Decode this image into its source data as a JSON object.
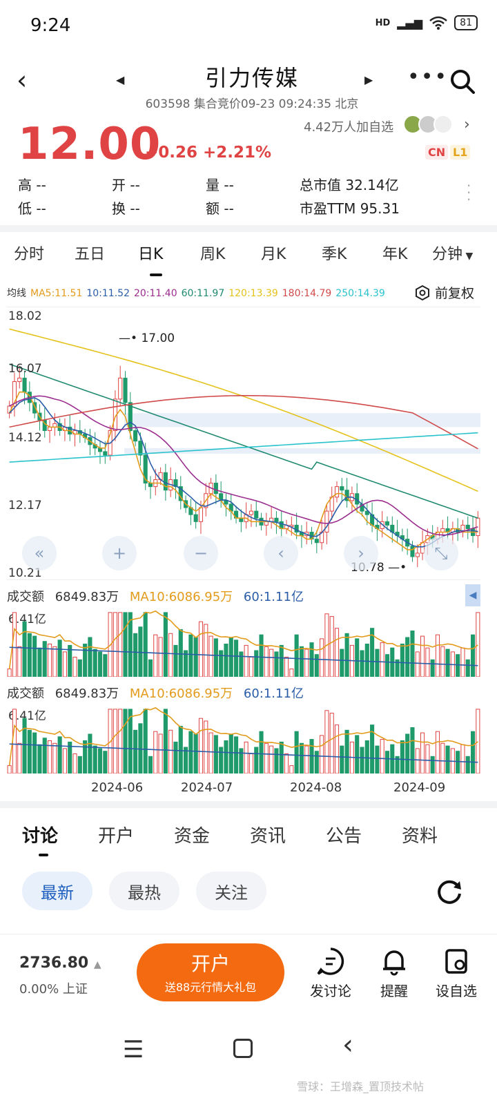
{
  "status": {
    "time": "9:24",
    "network": "HD",
    "battery": "81"
  },
  "header": {
    "title": "引力传媒",
    "subtitle": "603598 集合竞价09-23 09:24:35 北京"
  },
  "quote": {
    "price": "12.00",
    "change": "+0.26 +2.21%",
    "followers": "4.42万人加自选",
    "badge_cn": "CN",
    "badge_l1": "L1"
  },
  "stats": {
    "high_label": "高",
    "high": "--",
    "open_label": "开",
    "open": "--",
    "vol_label": "量",
    "vol": "--",
    "mcap": "总市值 32.14亿",
    "low_label": "低",
    "low": "--",
    "turn_label": "换",
    "turn": "--",
    "amt_label": "额",
    "amt": "--",
    "pe": "市盈TTM 95.31"
  },
  "tabs": [
    "分时",
    "五日",
    "日K",
    "周K",
    "月K",
    "季K",
    "年K",
    "分钟"
  ],
  "active_tab": "日K",
  "ma_legend": [
    {
      "text": "均线",
      "color": "#333333"
    },
    {
      "text": "MA5:11.51",
      "color": "#e39b1b"
    },
    {
      "text": "10:11.52",
      "color": "#2a5da8"
    },
    {
      "text": "20:11.40",
      "color": "#9b2d8e"
    },
    {
      "text": "60:11.97",
      "color": "#1f8a70"
    },
    {
      "text": "120:13.39",
      "color": "#e5c21a"
    },
    {
      "text": "180:14.79",
      "color": "#d04a4a"
    },
    {
      "text": "250:14.39",
      "color": "#29c2cc"
    }
  ],
  "fq_label": "前复权",
  "chart_data": {
    "type": "candlestick",
    "y_ticks": [
      "18.02",
      "16.07",
      "14.12",
      "12.17",
      "10.21"
    ],
    "ylim": [
      10.21,
      18.02
    ],
    "annotations": {
      "high": "17.00",
      "low": "10.78"
    },
    "x_labels": [
      "2024-06",
      "2024-07",
      "2024-08",
      "2024-09"
    ],
    "closes": [
      15.2,
      15.9,
      16.0,
      15.6,
      15.3,
      15.0,
      14.8,
      14.5,
      14.6,
      14.7,
      14.5,
      14.6,
      14.4,
      14.5,
      14.4,
      14.3,
      14.1,
      14.0,
      13.9,
      13.8,
      14.5,
      15.4,
      16.0,
      15.3,
      14.5,
      14.2,
      13.8,
      13.0,
      12.9,
      13.1,
      13.3,
      12.8,
      13.1,
      12.9,
      12.5,
      12.3,
      12.1,
      11.9,
      12.3,
      12.7,
      13.0,
      12.7,
      12.5,
      12.4,
      12.2,
      12.0,
      11.9,
      12.1,
      12.2,
      12.0,
      11.8,
      11.9,
      12.0,
      11.9,
      11.7,
      11.8,
      11.8,
      11.6,
      11.5,
      11.6,
      11.4,
      11.3,
      11.6,
      12.2,
      12.6,
      12.9,
      12.8,
      12.5,
      12.7,
      12.4,
      12.2,
      12.1,
      11.8,
      11.7,
      11.9,
      11.8,
      11.6,
      11.5,
      11.4,
      11.2,
      10.9,
      11.0,
      11.3,
      11.5,
      11.4,
      11.6,
      11.7,
      11.6,
      11.7,
      11.6,
      11.8,
      11.7,
      11.5,
      12.0
    ],
    "ma5": [
      15.0,
      15.3,
      15.6,
      15.6,
      15.5,
      15.2,
      14.9,
      14.7,
      14.6,
      14.6,
      14.6,
      14.5,
      14.5,
      14.4,
      14.4,
      14.3,
      14.2,
      14.1,
      14.0,
      14.0,
      14.4,
      14.9,
      15.1,
      14.9,
      14.4,
      13.9,
      13.4,
      13.1,
      13.0,
      13.0,
      13.0,
      12.9,
      12.9,
      12.8,
      12.6,
      12.4,
      12.3,
      12.2,
      12.3,
      12.5,
      12.7,
      12.6,
      12.5,
      12.3,
      12.2,
      12.0,
      12.0,
      12.0,
      11.9,
      11.9,
      11.9,
      11.9,
      11.9,
      11.8,
      11.7,
      11.7,
      11.6,
      11.5,
      11.5,
      11.4,
      11.4,
      11.6,
      12.0,
      12.4,
      12.6,
      12.7,
      12.7,
      12.6,
      12.4,
      12.2,
      12.1,
      11.9,
      11.8,
      11.7,
      11.6,
      11.5,
      11.4,
      11.3,
      11.2,
      11.1,
      11.1,
      11.2,
      11.3,
      11.4,
      11.5,
      11.6,
      11.6,
      11.6,
      11.7,
      11.7,
      11.6,
      11.6,
      11.6,
      11.6
    ],
    "volume_title": "成交额",
    "volume": "6849.83万",
    "volume_ma10": "MA10:6086.95万",
    "volume_ma60": "60:1.11亿",
    "volume_max": "6.41亿"
  },
  "chart_nav": [
    "«",
    "+",
    "−",
    "‹",
    "›",
    "⤡"
  ],
  "bottom_tabs": [
    "讨论",
    "开户",
    "资金",
    "资讯",
    "公告",
    "资料"
  ],
  "filters": [
    "最新",
    "最热",
    "关注"
  ],
  "index": {
    "value": "2736.80",
    "change": "0.00% 上证"
  },
  "open_account": {
    "title": "开户",
    "subtitle": "送88元行情大礼包"
  },
  "actions": [
    "发讨论",
    "提醒",
    "设自选"
  ],
  "watermark": "雪球：王增森_置顶技术帖"
}
